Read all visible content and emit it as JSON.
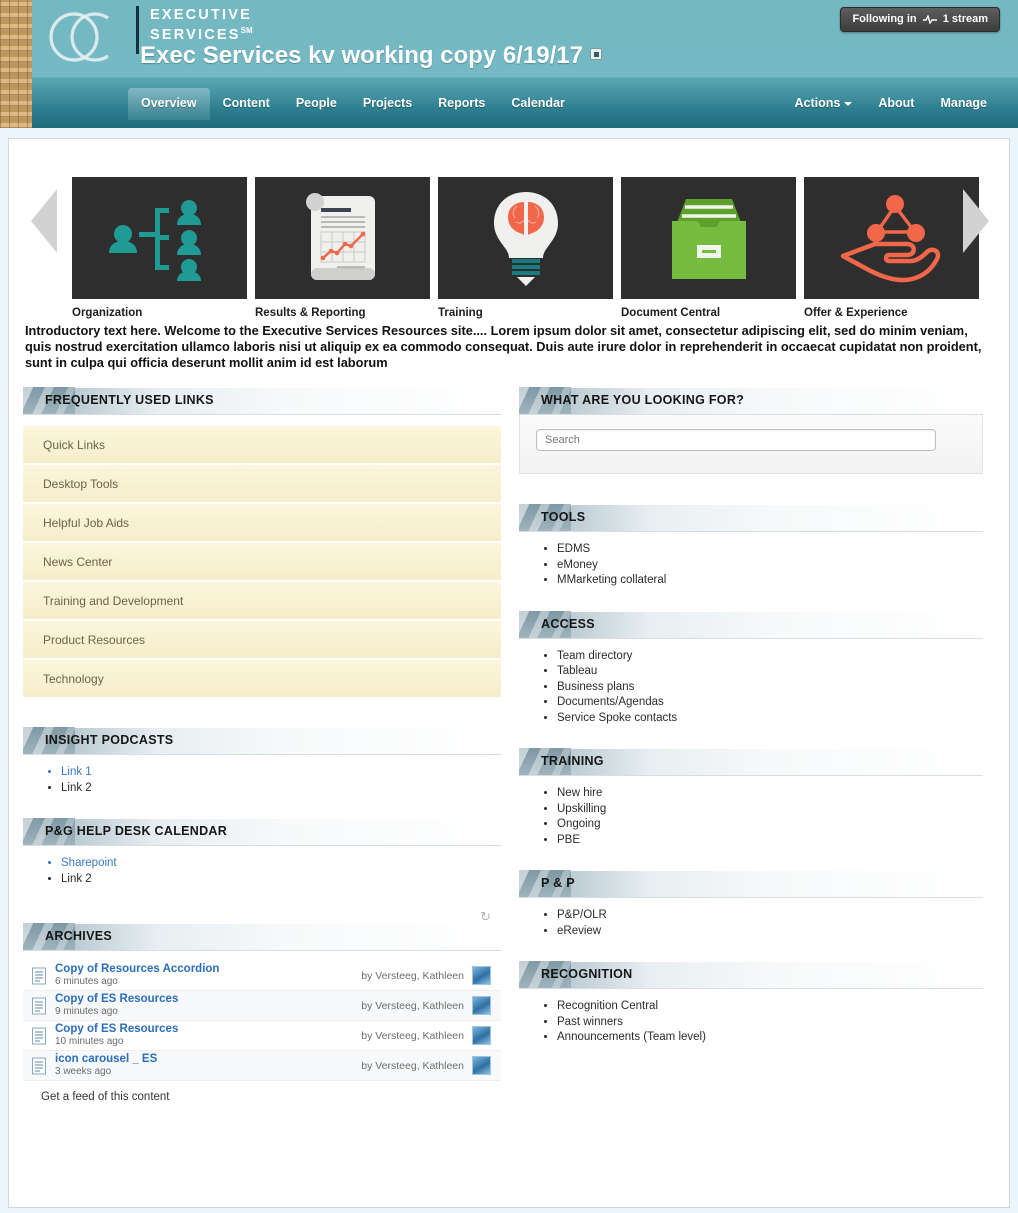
{
  "header": {
    "brand_line1": "EXECUTIVE",
    "brand_line2": "SERVICES",
    "brand_sm": "SM",
    "site_title": "Exec Services kv working copy 6/19/17",
    "following_label": "Following in",
    "following_count": "1 stream"
  },
  "nav": {
    "left_items": [
      {
        "label": "Overview",
        "active": true
      },
      {
        "label": "Content",
        "active": false
      },
      {
        "label": "People",
        "active": false
      },
      {
        "label": "Projects",
        "active": false
      },
      {
        "label": "Reports",
        "active": false
      },
      {
        "label": "Calendar",
        "active": false
      }
    ],
    "right_items": [
      {
        "label": "Actions",
        "caret": true
      },
      {
        "label": "About",
        "caret": false
      },
      {
        "label": "Manage",
        "caret": false
      }
    ]
  },
  "carousel": {
    "tiles": [
      {
        "label": "Organization",
        "icon": "org-chart-icon"
      },
      {
        "label": "Results & Reporting",
        "icon": "report-scroll-icon"
      },
      {
        "label": "Training",
        "icon": "lightbulb-brain-icon"
      },
      {
        "label": "Document Central",
        "icon": "file-box-icon"
      },
      {
        "label": "Offer & Experience",
        "icon": "hand-network-icon"
      }
    ]
  },
  "intro_text": "Introductory text here. Welcome to the Executive Services Resources site.... Lorem ipsum dolor sit amet, consectetur adipiscing elit, sed do minim veniam, quis nostrud exercitation ullamco laboris nisi ut aliquip ex ea commodo consequat. Duis aute irure dolor in reprehenderit in occaecat cupidatat non proident, sunt in culpa qui officia deserunt mollit anim id est laborum",
  "left_column": {
    "frequently_used_links": {
      "title": "FREQUENTLY USED LINKS",
      "items": [
        "Quick Links",
        "Desktop Tools",
        "Helpful Job Aids",
        "News Center",
        "Training and Development",
        "Product Resources",
        "Technology"
      ]
    },
    "insight_podcasts": {
      "title": "INSIGHT PODCASTS",
      "items": [
        {
          "label": "Link 1",
          "is_link": true
        },
        {
          "label": "Link 2",
          "is_link": false
        }
      ]
    },
    "help_desk_calendar": {
      "title": "P&G HELP DESK CALENDAR",
      "items": [
        {
          "label": "Sharepoint",
          "is_link": true
        },
        {
          "label": "Link 2",
          "is_link": false
        }
      ]
    },
    "archives": {
      "title": "ARCHIVES",
      "refresh_icon": "refresh-icon",
      "rows": [
        {
          "title": "Copy of Resources Accordion",
          "time": "6 minutes ago",
          "by": "by Versteeg, Kathleen"
        },
        {
          "title": "Copy of ES Resources",
          "time": "9 minutes ago",
          "by": "by Versteeg, Kathleen"
        },
        {
          "title": "Copy of ES Resources",
          "time": "10 minutes ago",
          "by": "by Versteeg, Kathleen"
        },
        {
          "title": "icon carousel _ ES",
          "time": "3 weeks ago",
          "by": "by Versteeg, Kathleen"
        }
      ],
      "feed_link": "Get a feed of this content"
    }
  },
  "right_column": {
    "search": {
      "title": "WHAT ARE YOU LOOKING FOR?",
      "placeholder": "Search",
      "value": ""
    },
    "tools": {
      "title": "TOOLS",
      "items": [
        "EDMS",
        "eMoney",
        "MMarketing collateral"
      ]
    },
    "access": {
      "title": "ACCESS",
      "items": [
        "Team directory",
        "Tableau",
        "Business plans",
        "Documents/Agendas",
        "Service Spoke contacts"
      ]
    },
    "training": {
      "title": "TRAINING",
      "items": [
        "New hire",
        "Upskilling",
        "Ongoing",
        "PBE"
      ]
    },
    "pp": {
      "title": "P & P",
      "items": [
        "P&P/OLR",
        "eReview"
      ]
    },
    "recognition": {
      "title": "RECOGNITION",
      "items": [
        "Recognition Central",
        "Past winners",
        "Announcements (Team level)"
      ]
    }
  },
  "colors": {
    "header_teal": "#74b8c2",
    "header_teal_dark": "#1e6b7c",
    "accordion_cream": "#fbf6dd",
    "link_blue": "#2a6ebb",
    "icon_teal": "#1f9a94",
    "icon_orange": "#f2674a",
    "icon_green": "#76bd3f"
  }
}
